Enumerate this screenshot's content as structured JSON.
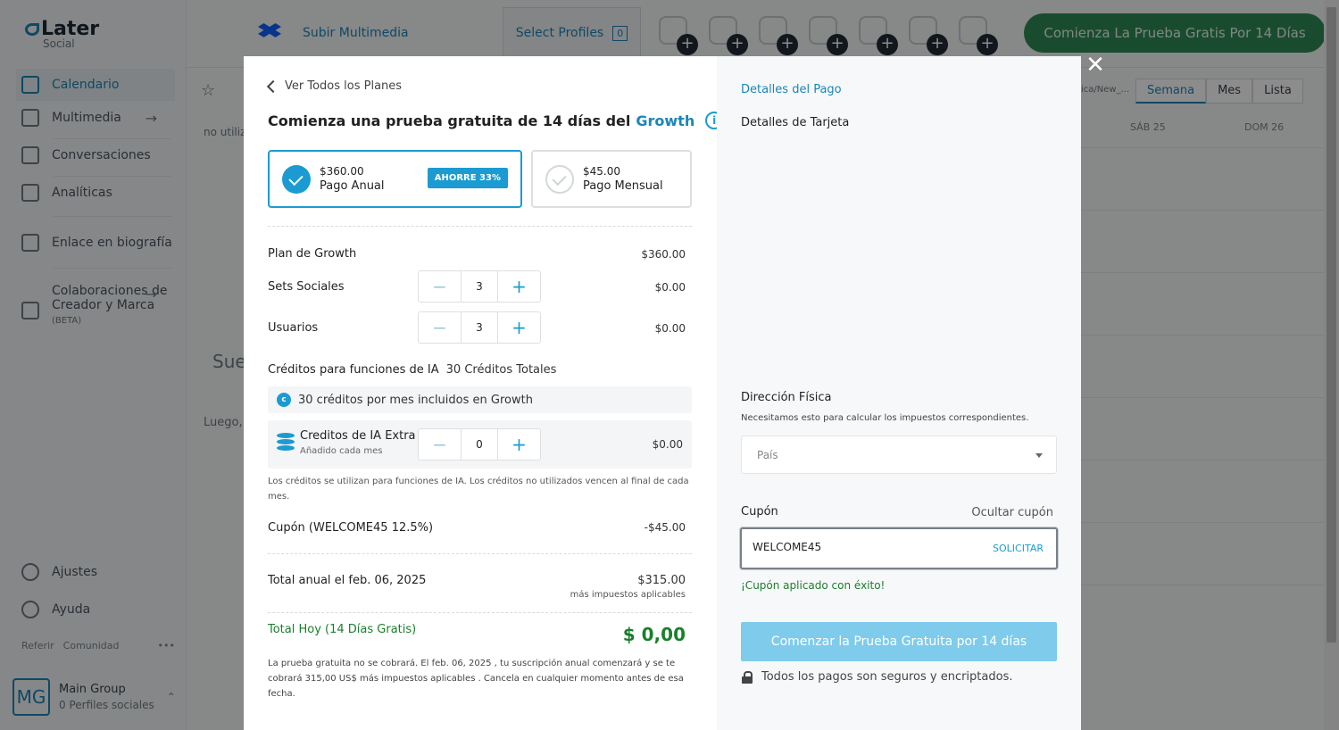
{
  "sidebar": {
    "logo": {
      "name": "Later",
      "sub": "Social"
    },
    "items": [
      {
        "label": "Calendario",
        "icon": "calendar-icon"
      },
      {
        "label": "Multimedia",
        "icon": "media-icon"
      },
      {
        "label": "Conversaciones",
        "icon": "chat-icon"
      },
      {
        "label": "Analíticas",
        "icon": "chart-icon"
      },
      {
        "label": "Enlace en biografía",
        "icon": "link-icon"
      },
      {
        "label": "Colaboraciones de Creador y Marca",
        "line1": "Colaboraciones de",
        "line2": "Creador y Marca",
        "badge": "(BETA)",
        "icon": "collab-icon"
      }
    ],
    "settings": "Ajustes",
    "help": "Ayuda",
    "footer": {
      "refer": "Referir",
      "community": "Comunidad"
    },
    "group": {
      "initials": "MG",
      "name": "Main Group",
      "profiles": "0 Perfiles sociales"
    }
  },
  "topbar": {
    "upload": "Subir Multimedia",
    "select_profiles": "Select Profiles",
    "select_count": "0",
    "trial_button": "Comienza La Prueba Gratis Por 14 Días"
  },
  "calendar": {
    "tabs": [
      "Semana",
      "Mes",
      "Lista"
    ],
    "path": "ica/New_...",
    "days": [
      "SÁB 25",
      "DOM 26"
    ],
    "no_use": "no utiliz",
    "sue": "Sue",
    "luego": "Luego,"
  },
  "modal": {
    "back": "Ver Todos los Planes",
    "title": "Comienza una prueba gratuita de 14 días del",
    "title_plan": "Growth",
    "plans": {
      "annual": {
        "price": "$360.00",
        "name": "Pago Anual",
        "badge": "AHORRE 33%"
      },
      "monthly": {
        "price": "$45.00",
        "name": "Pago Mensual"
      }
    },
    "plan_row": {
      "label": "Plan de Growth",
      "value": "$360.00"
    },
    "social_sets": {
      "label": "Sets Sociales",
      "qty": "3",
      "value": "$0.00"
    },
    "users": {
      "label": "Usuarios",
      "qty": "3",
      "value": "$0.00"
    },
    "credits": {
      "heading": "Créditos para funciones de IA",
      "total": "30 Créditos Totales",
      "included": "30 créditos por mes incluidos en Growth",
      "extra_name": "Creditos de IA Extra",
      "extra_sub": "Añadido cada mes",
      "extra_qty": "0",
      "extra_value": "$0.00",
      "note": "Los créditos se utilizan para funciones de IA. Los créditos no utilizados vencen al final de cada mes."
    },
    "coupon_row": {
      "label": "Cupón (WELCOME45 12.5%)",
      "value": "-$45.00"
    },
    "annual_total": {
      "label": "Total anual el feb. 06, 2025",
      "value": "$315.00",
      "sub": "más impuestos aplicables"
    },
    "today_total": {
      "label": "Total Hoy (14 Días Gratis)",
      "value": "$ 0,00"
    },
    "fine_print": "La prueba gratuita no se cobrará. El feb. 06, 2025 , tu suscripción anual comenzará y se te cobrará 315,00 US$ más impuestos aplicables . Cancela en cualquier momento antes de esa fecha.",
    "payment": {
      "title": "Detalles del Pago",
      "card_title": "Detalles de Tarjeta",
      "address_title": "Dirección Física",
      "address_sub": "Necesitamos esto para calcular los impuestos correspondientes.",
      "country_placeholder": "País",
      "coupon_title": "Cupón",
      "hide_coupon": "Ocultar cupón",
      "coupon_value": "WELCOME45",
      "apply": "SOLICITAR",
      "success": "¡Cupón aplicado con éxito!",
      "start_button": "Comenzar la Prueba Gratuita por 14 días",
      "secure": "Todos los pagos son seguros y encriptados."
    }
  },
  "colors": {
    "accent": "#1b9bd1",
    "success": "#1a7f2c",
    "trial_green": "#2f8a55"
  }
}
